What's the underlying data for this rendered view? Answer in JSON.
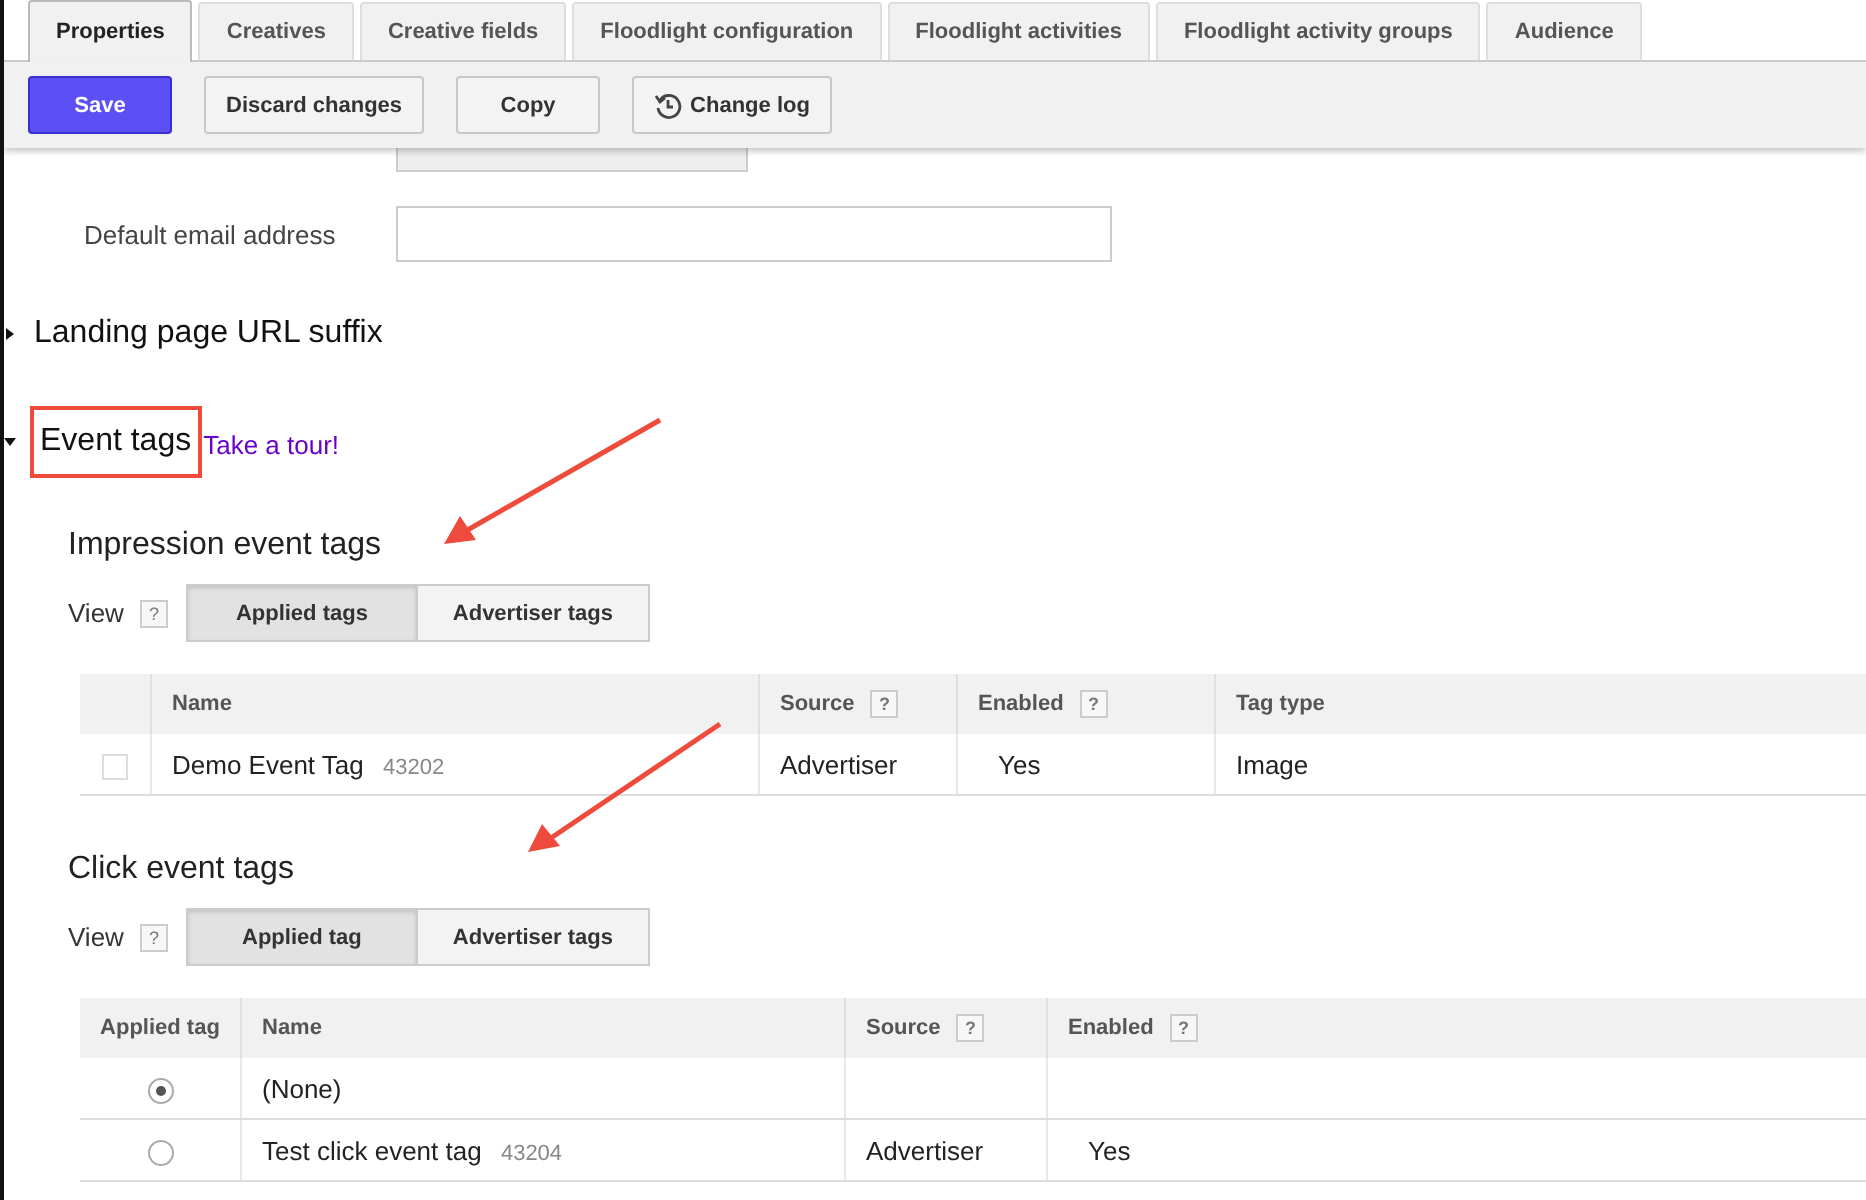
{
  "tabs": [
    {
      "label": "Properties",
      "selected": true
    },
    {
      "label": "Creatives",
      "selected": false
    },
    {
      "label": "Creative fields",
      "selected": false
    },
    {
      "label": "Floodlight configuration",
      "selected": false
    },
    {
      "label": "Floodlight activities",
      "selected": false
    },
    {
      "label": "Floodlight activity groups",
      "selected": false
    },
    {
      "label": "Audience",
      "selected": false
    }
  ],
  "toolbar": [
    {
      "label": "Save",
      "kind": "primary"
    },
    {
      "label": "Discard changes",
      "kind": "plain"
    },
    {
      "label": "Copy",
      "kind": "plain"
    },
    {
      "label": "Change log",
      "kind": "history"
    }
  ],
  "email_field": {
    "label": "Default email address"
  },
  "sections": [
    {
      "title": "Landing page URL suffix",
      "expanded": false,
      "highlighted": false
    },
    {
      "title": "Event tags",
      "expanded": true,
      "highlighted": true,
      "link": "Take a tour!"
    }
  ],
  "impression_tags": {
    "title": "Impression event tags",
    "view_label": "View",
    "help": "?",
    "views": [
      {
        "label": "Applied tags",
        "selected": true
      },
      {
        "label": "Advertiser tags",
        "selected": false
      }
    ],
    "columns": [
      {},
      {
        "label": "Name"
      },
      {
        "label": "Source",
        "help": "?"
      },
      {
        "label": "Enabled",
        "help": "?"
      },
      {
        "label": "Tag type"
      }
    ],
    "rows": [
      {
        "checked": false,
        "name": "Demo Event Tag",
        "id": "43202",
        "source": "Advertiser",
        "enabled": "Yes",
        "tag_type": "Image"
      }
    ]
  },
  "click_tags": {
    "title": "Click event tags",
    "view_label": "View",
    "help": "?",
    "views": [
      {
        "label": "Applied tag",
        "selected": true
      },
      {
        "label": "Advertiser tags",
        "selected": false
      }
    ],
    "columns": [
      {
        "label": "Applied tag"
      },
      {
        "label": "Name"
      },
      {
        "label": "Source",
        "help": "?"
      },
      {
        "label": "Enabled",
        "help": "?"
      }
    ],
    "rows": [
      {
        "selected": true,
        "name": "(None)"
      },
      {
        "selected": false,
        "name": "Test click event tag",
        "id": "43204",
        "source": "Advertiser",
        "enabled": "Yes"
      }
    ]
  }
}
